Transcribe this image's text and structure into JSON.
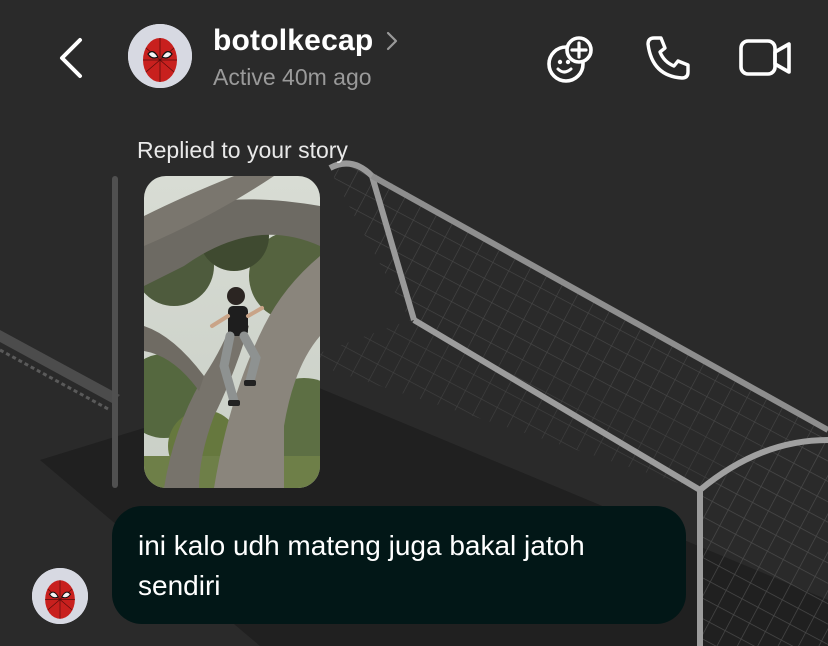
{
  "header": {
    "username": "botolkecap",
    "status": "Active 40m ago",
    "icons": {
      "back": "chevron-left-icon",
      "profile_chevron": "chevron-right-icon",
      "games": "games-icon",
      "call": "phone-icon",
      "video": "video-camera-icon"
    }
  },
  "reply": {
    "label": "Replied to your story"
  },
  "message": {
    "text": "ini kalo udh mateng juga bakal jatoh sendiri"
  },
  "colors": {
    "background": "#2a2a2a",
    "bubble": "#021717",
    "status_text": "#9a9a9a",
    "reply_bar": "#505050"
  }
}
